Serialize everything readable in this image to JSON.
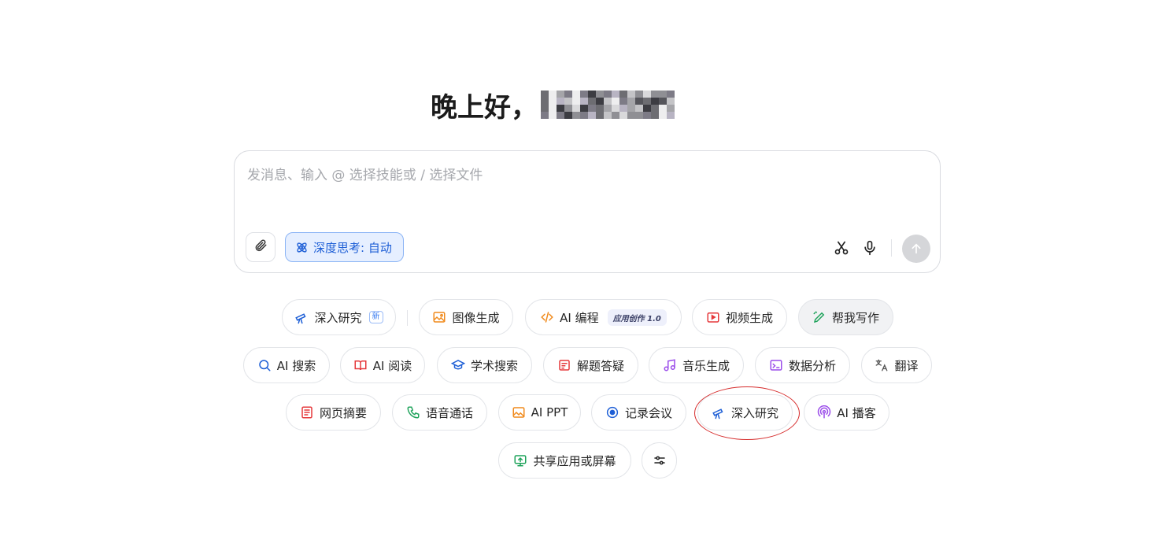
{
  "greeting": {
    "text": "晚上好，"
  },
  "composer": {
    "placeholder": "发消息、输入 @ 选择技能或 / 选择文件",
    "deep_think_label": "深度思考: 自动"
  },
  "skills": {
    "row1": [
      {
        "label": "深入研究",
        "icon": "telescope-icon",
        "badge": "新"
      },
      {
        "label": "图像生成",
        "icon": "image-gen-icon"
      },
      {
        "label": "AI 编程",
        "icon": "code-icon",
        "badge": "应用创作 1.0"
      },
      {
        "label": "视频生成",
        "icon": "video-icon"
      },
      {
        "label": "帮我写作",
        "icon": "pen-icon"
      }
    ],
    "row2": [
      {
        "label": "AI 搜索",
        "icon": "search-icon"
      },
      {
        "label": "AI 阅读",
        "icon": "book-icon"
      },
      {
        "label": "学术搜索",
        "icon": "graduation-cap-icon"
      },
      {
        "label": "解题答疑",
        "icon": "solve-icon"
      },
      {
        "label": "音乐生成",
        "icon": "music-icon"
      },
      {
        "label": "数据分析",
        "icon": "data-analysis-icon"
      },
      {
        "label": "翻译",
        "icon": "translate-icon"
      }
    ],
    "row3": [
      {
        "label": "网页摘要",
        "icon": "webpage-summary-icon"
      },
      {
        "label": "语音通话",
        "icon": "phone-icon"
      },
      {
        "label": "AI PPT",
        "icon": "ppt-icon"
      },
      {
        "label": "记录会议",
        "icon": "record-icon"
      },
      {
        "label": "深入研究",
        "icon": "telescope-icon"
      },
      {
        "label": "AI 播客",
        "icon": "podcast-icon"
      }
    ],
    "row4": [
      {
        "label": "共享应用或屏幕",
        "icon": "share-screen-icon"
      },
      {
        "label": "",
        "icon": "settings-sliders-icon"
      }
    ]
  },
  "colors": {
    "accent_blue": "#1e5fd6",
    "annotation_red": "#d62c2c"
  }
}
